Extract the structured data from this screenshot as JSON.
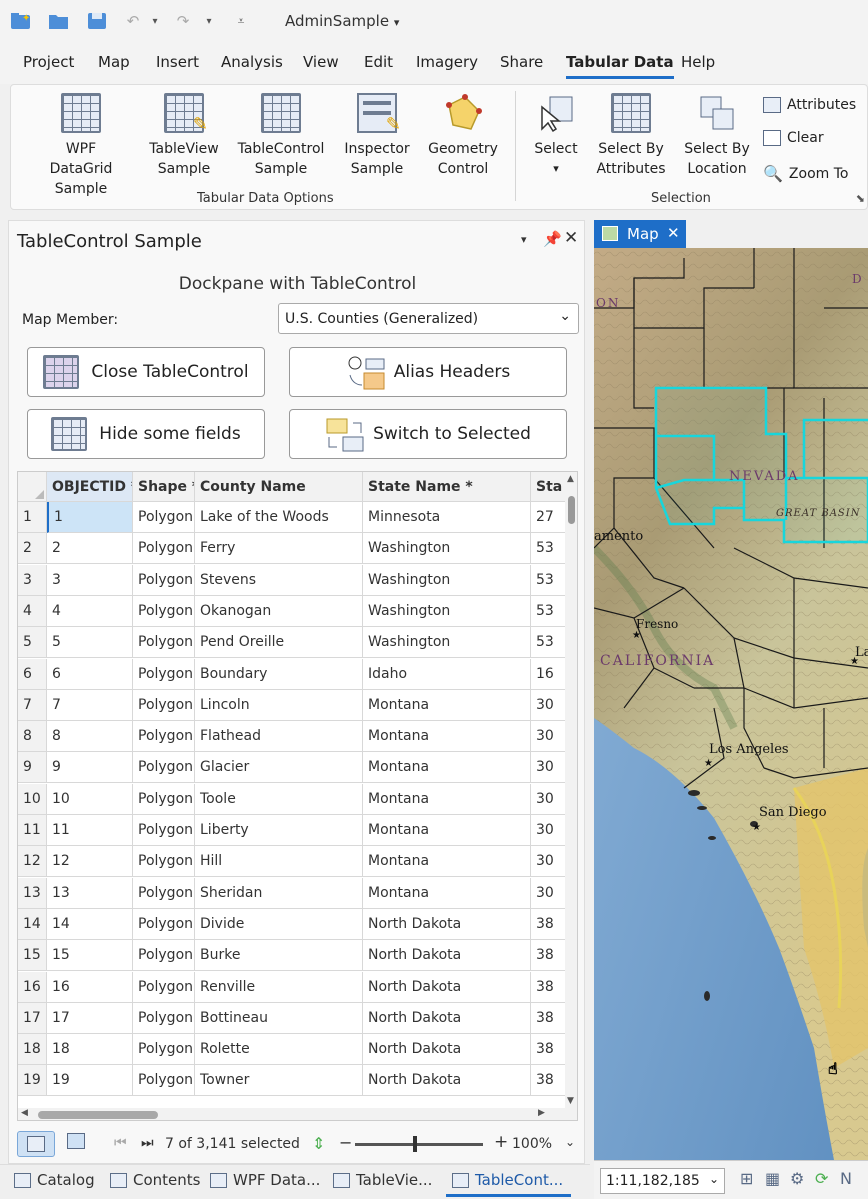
{
  "app": {
    "project_title": "AdminSample",
    "menu": [
      "Project",
      "Map",
      "Insert",
      "Analysis",
      "View",
      "Edit",
      "Imagery",
      "Share",
      "Tabular Data",
      "Help"
    ],
    "active_menu": "Tabular Data"
  },
  "ribbon": {
    "groups": {
      "tabular_options": "Tabular Data Options",
      "selection": "Selection"
    },
    "buttons": {
      "wpf_datagrid": [
        "WPF DataGrid",
        "Sample"
      ],
      "tableview": [
        "TableView",
        "Sample"
      ],
      "tablecontrol": [
        "TableControl",
        "Sample"
      ],
      "inspector": [
        "Inspector",
        "Sample"
      ],
      "geometry": [
        "Geometry",
        "Control"
      ],
      "select": "Select",
      "select_by_attributes": [
        "Select By",
        "Attributes"
      ],
      "select_by_location": [
        "Select By",
        "Location"
      ],
      "attributes": "Attributes",
      "clear": "Clear",
      "zoom_to": "Zoom To"
    }
  },
  "pane": {
    "title": "TableControl Sample",
    "subtitle": "Dockpane with TableControl",
    "map_member_label": "Map Member:",
    "map_member_value": "U.S. Counties (Generalized)",
    "btn_close_table": "Close TableControl",
    "btn_alias": "Alias Headers",
    "btn_hide": "Hide some fields",
    "btn_switch": "Switch to Selected"
  },
  "table": {
    "columns": [
      "OBJECTID *",
      "Shape *",
      "County Name",
      "State Name *",
      "Sta"
    ],
    "rows": [
      [
        "1",
        "1",
        "Polygon",
        "Lake of the Woods",
        "Minnesota",
        "27"
      ],
      [
        "2",
        "2",
        "Polygon",
        "Ferry",
        "Washington",
        "53"
      ],
      [
        "3",
        "3",
        "Polygon",
        "Stevens",
        "Washington",
        "53"
      ],
      [
        "4",
        "4",
        "Polygon",
        "Okanogan",
        "Washington",
        "53"
      ],
      [
        "5",
        "5",
        "Polygon",
        "Pend Oreille",
        "Washington",
        "53"
      ],
      [
        "6",
        "6",
        "Polygon",
        "Boundary",
        "Idaho",
        "16"
      ],
      [
        "7",
        "7",
        "Polygon",
        "Lincoln",
        "Montana",
        "30"
      ],
      [
        "8",
        "8",
        "Polygon",
        "Flathead",
        "Montana",
        "30"
      ],
      [
        "9",
        "9",
        "Polygon",
        "Glacier",
        "Montana",
        "30"
      ],
      [
        "10",
        "10",
        "Polygon",
        "Toole",
        "Montana",
        "30"
      ],
      [
        "11",
        "11",
        "Polygon",
        "Liberty",
        "Montana",
        "30"
      ],
      [
        "12",
        "12",
        "Polygon",
        "Hill",
        "Montana",
        "30"
      ],
      [
        "13",
        "13",
        "Polygon",
        "Sheridan",
        "Montana",
        "30"
      ],
      [
        "14",
        "14",
        "Polygon",
        "Divide",
        "North Dakota",
        "38"
      ],
      [
        "15",
        "15",
        "Polygon",
        "Burke",
        "North Dakota",
        "38"
      ],
      [
        "16",
        "16",
        "Polygon",
        "Renville",
        "North Dakota",
        "38"
      ],
      [
        "17",
        "17",
        "Polygon",
        "Bottineau",
        "North Dakota",
        "38"
      ],
      [
        "18",
        "18",
        "Polygon",
        "Rolette",
        "North Dakota",
        "38"
      ],
      [
        "19",
        "19",
        "Polygon",
        "Towner",
        "North Dakota",
        "38"
      ]
    ],
    "selected_count": "7 of 3,141 selected",
    "zoom": "100%"
  },
  "bottom_tabs": [
    "Catalog",
    "Contents",
    "WPF Data...",
    "TableVie...",
    "TableCont..."
  ],
  "map": {
    "tab_label": "Map",
    "labels": [
      "NEVADA",
      "GREAT BASIN",
      "CALIFORNIA",
      "Fresno",
      "Los Angeles",
      "San Diego",
      "amento",
      "ON",
      "La",
      "D"
    ],
    "scale": "1:11,182,185"
  },
  "colors": {
    "accent": "#1e6ec8",
    "selection_outline": "#17d6dc",
    "selected_cell": "#cde4f7"
  }
}
